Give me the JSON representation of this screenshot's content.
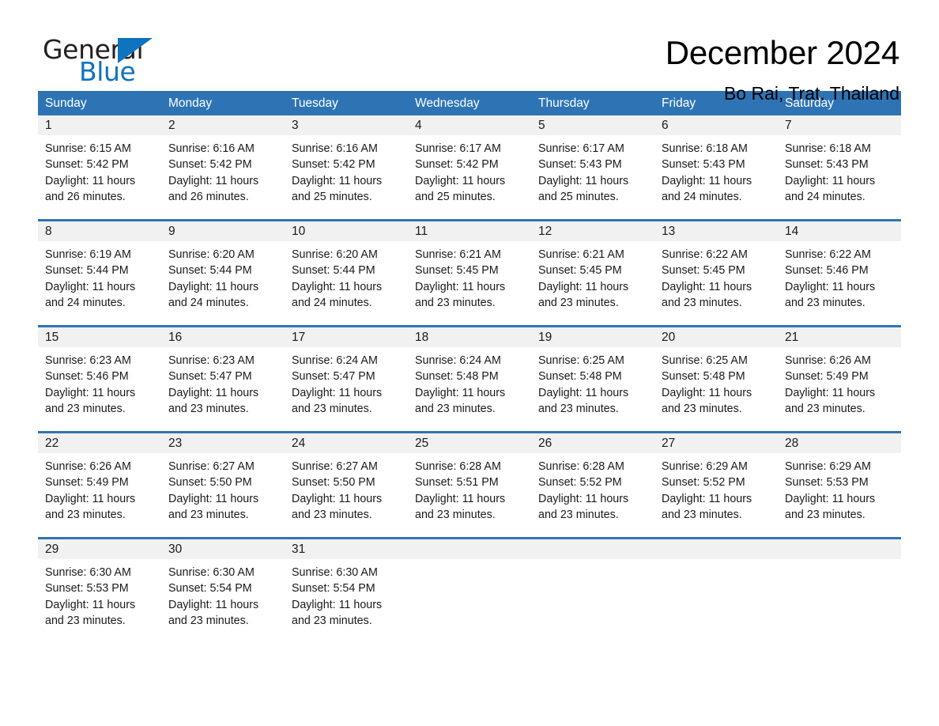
{
  "brand": {
    "name_part1": "General",
    "name_part2": "Blue",
    "triangle_color": "#1073bd",
    "logo_icon": "triangle-logo-icon"
  },
  "header": {
    "title": "December 2024",
    "subtitle": "Bo Rai, Trat, Thailand"
  },
  "colors": {
    "header_blue": "#2e74b5",
    "day_strip_gray": "#f1f1f1",
    "brand_blue": "#1073bd",
    "text": "#1a1a1a"
  },
  "weekdays": [
    "Sunday",
    "Monday",
    "Tuesday",
    "Wednesday",
    "Thursday",
    "Friday",
    "Saturday"
  ],
  "weeks": [
    [
      {
        "day": "1",
        "sunrise": "Sunrise: 6:15 AM",
        "sunset": "Sunset: 5:42 PM",
        "daylight_line1": "Daylight: 11 hours",
        "daylight_line2": "and 26 minutes."
      },
      {
        "day": "2",
        "sunrise": "Sunrise: 6:16 AM",
        "sunset": "Sunset: 5:42 PM",
        "daylight_line1": "Daylight: 11 hours",
        "daylight_line2": "and 26 minutes."
      },
      {
        "day": "3",
        "sunrise": "Sunrise: 6:16 AM",
        "sunset": "Sunset: 5:42 PM",
        "daylight_line1": "Daylight: 11 hours",
        "daylight_line2": "and 25 minutes."
      },
      {
        "day": "4",
        "sunrise": "Sunrise: 6:17 AM",
        "sunset": "Sunset: 5:42 PM",
        "daylight_line1": "Daylight: 11 hours",
        "daylight_line2": "and 25 minutes."
      },
      {
        "day": "5",
        "sunrise": "Sunrise: 6:17 AM",
        "sunset": "Sunset: 5:43 PM",
        "daylight_line1": "Daylight: 11 hours",
        "daylight_line2": "and 25 minutes."
      },
      {
        "day": "6",
        "sunrise": "Sunrise: 6:18 AM",
        "sunset": "Sunset: 5:43 PM",
        "daylight_line1": "Daylight: 11 hours",
        "daylight_line2": "and 24 minutes."
      },
      {
        "day": "7",
        "sunrise": "Sunrise: 6:18 AM",
        "sunset": "Sunset: 5:43 PM",
        "daylight_line1": "Daylight: 11 hours",
        "daylight_line2": "and 24 minutes."
      }
    ],
    [
      {
        "day": "8",
        "sunrise": "Sunrise: 6:19 AM",
        "sunset": "Sunset: 5:44 PM",
        "daylight_line1": "Daylight: 11 hours",
        "daylight_line2": "and 24 minutes."
      },
      {
        "day": "9",
        "sunrise": "Sunrise: 6:20 AM",
        "sunset": "Sunset: 5:44 PM",
        "daylight_line1": "Daylight: 11 hours",
        "daylight_line2": "and 24 minutes."
      },
      {
        "day": "10",
        "sunrise": "Sunrise: 6:20 AM",
        "sunset": "Sunset: 5:44 PM",
        "daylight_line1": "Daylight: 11 hours",
        "daylight_line2": "and 24 minutes."
      },
      {
        "day": "11",
        "sunrise": "Sunrise: 6:21 AM",
        "sunset": "Sunset: 5:45 PM",
        "daylight_line1": "Daylight: 11 hours",
        "daylight_line2": "and 23 minutes."
      },
      {
        "day": "12",
        "sunrise": "Sunrise: 6:21 AM",
        "sunset": "Sunset: 5:45 PM",
        "daylight_line1": "Daylight: 11 hours",
        "daylight_line2": "and 23 minutes."
      },
      {
        "day": "13",
        "sunrise": "Sunrise: 6:22 AM",
        "sunset": "Sunset: 5:45 PM",
        "daylight_line1": "Daylight: 11 hours",
        "daylight_line2": "and 23 minutes."
      },
      {
        "day": "14",
        "sunrise": "Sunrise: 6:22 AM",
        "sunset": "Sunset: 5:46 PM",
        "daylight_line1": "Daylight: 11 hours",
        "daylight_line2": "and 23 minutes."
      }
    ],
    [
      {
        "day": "15",
        "sunrise": "Sunrise: 6:23 AM",
        "sunset": "Sunset: 5:46 PM",
        "daylight_line1": "Daylight: 11 hours",
        "daylight_line2": "and 23 minutes."
      },
      {
        "day": "16",
        "sunrise": "Sunrise: 6:23 AM",
        "sunset": "Sunset: 5:47 PM",
        "daylight_line1": "Daylight: 11 hours",
        "daylight_line2": "and 23 minutes."
      },
      {
        "day": "17",
        "sunrise": "Sunrise: 6:24 AM",
        "sunset": "Sunset: 5:47 PM",
        "daylight_line1": "Daylight: 11 hours",
        "daylight_line2": "and 23 minutes."
      },
      {
        "day": "18",
        "sunrise": "Sunrise: 6:24 AM",
        "sunset": "Sunset: 5:48 PM",
        "daylight_line1": "Daylight: 11 hours",
        "daylight_line2": "and 23 minutes."
      },
      {
        "day": "19",
        "sunrise": "Sunrise: 6:25 AM",
        "sunset": "Sunset: 5:48 PM",
        "daylight_line1": "Daylight: 11 hours",
        "daylight_line2": "and 23 minutes."
      },
      {
        "day": "20",
        "sunrise": "Sunrise: 6:25 AM",
        "sunset": "Sunset: 5:48 PM",
        "daylight_line1": "Daylight: 11 hours",
        "daylight_line2": "and 23 minutes."
      },
      {
        "day": "21",
        "sunrise": "Sunrise: 6:26 AM",
        "sunset": "Sunset: 5:49 PM",
        "daylight_line1": "Daylight: 11 hours",
        "daylight_line2": "and 23 minutes."
      }
    ],
    [
      {
        "day": "22",
        "sunrise": "Sunrise: 6:26 AM",
        "sunset": "Sunset: 5:49 PM",
        "daylight_line1": "Daylight: 11 hours",
        "daylight_line2": "and 23 minutes."
      },
      {
        "day": "23",
        "sunrise": "Sunrise: 6:27 AM",
        "sunset": "Sunset: 5:50 PM",
        "daylight_line1": "Daylight: 11 hours",
        "daylight_line2": "and 23 minutes."
      },
      {
        "day": "24",
        "sunrise": "Sunrise: 6:27 AM",
        "sunset": "Sunset: 5:50 PM",
        "daylight_line1": "Daylight: 11 hours",
        "daylight_line2": "and 23 minutes."
      },
      {
        "day": "25",
        "sunrise": "Sunrise: 6:28 AM",
        "sunset": "Sunset: 5:51 PM",
        "daylight_line1": "Daylight: 11 hours",
        "daylight_line2": "and 23 minutes."
      },
      {
        "day": "26",
        "sunrise": "Sunrise: 6:28 AM",
        "sunset": "Sunset: 5:52 PM",
        "daylight_line1": "Daylight: 11 hours",
        "daylight_line2": "and 23 minutes."
      },
      {
        "day": "27",
        "sunrise": "Sunrise: 6:29 AM",
        "sunset": "Sunset: 5:52 PM",
        "daylight_line1": "Daylight: 11 hours",
        "daylight_line2": "and 23 minutes."
      },
      {
        "day": "28",
        "sunrise": "Sunrise: 6:29 AM",
        "sunset": "Sunset: 5:53 PM",
        "daylight_line1": "Daylight: 11 hours",
        "daylight_line2": "and 23 minutes."
      }
    ],
    [
      {
        "day": "29",
        "sunrise": "Sunrise: 6:30 AM",
        "sunset": "Sunset: 5:53 PM",
        "daylight_line1": "Daylight: 11 hours",
        "daylight_line2": "and 23 minutes."
      },
      {
        "day": "30",
        "sunrise": "Sunrise: 6:30 AM",
        "sunset": "Sunset: 5:54 PM",
        "daylight_line1": "Daylight: 11 hours",
        "daylight_line2": "and 23 minutes."
      },
      {
        "day": "31",
        "sunrise": "Sunrise: 6:30 AM",
        "sunset": "Sunset: 5:54 PM",
        "daylight_line1": "Daylight: 11 hours",
        "daylight_line2": "and 23 minutes."
      },
      {
        "day": "",
        "sunrise": "",
        "sunset": "",
        "daylight_line1": "",
        "daylight_line2": ""
      },
      {
        "day": "",
        "sunrise": "",
        "sunset": "",
        "daylight_line1": "",
        "daylight_line2": ""
      },
      {
        "day": "",
        "sunrise": "",
        "sunset": "",
        "daylight_line1": "",
        "daylight_line2": ""
      },
      {
        "day": "",
        "sunrise": "",
        "sunset": "",
        "daylight_line1": "",
        "daylight_line2": ""
      }
    ]
  ]
}
